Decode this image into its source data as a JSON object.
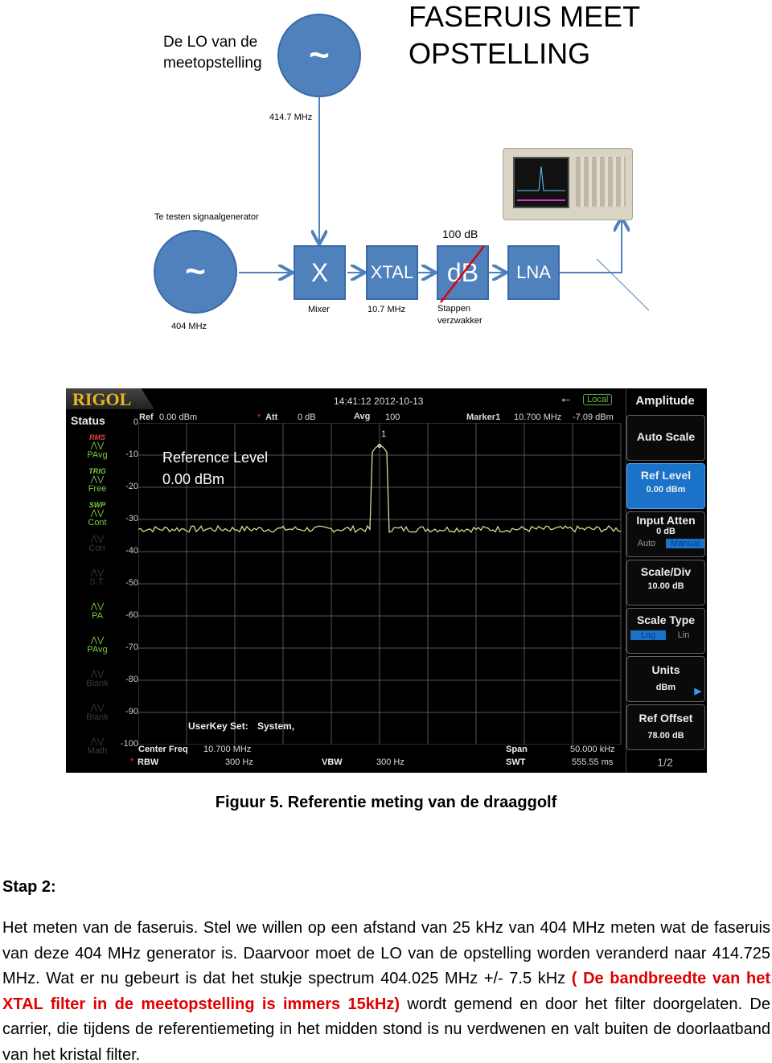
{
  "diagram": {
    "title_line1": "FASERUIS MEET",
    "title_line2": "OPSTELLING",
    "lo_label_line1": "De LO van de",
    "lo_label_line2": "meetopstelling",
    "lo_symbol": "~",
    "lo_freq": "414.7 MHz",
    "generator_label": "Te testen signaalgenerator",
    "generator_symbol": "~",
    "generator_freq": "404 MHz",
    "blocks": [
      {
        "label": "X",
        "caption": "Mixer"
      },
      {
        "label": "XTAL",
        "caption": "10.7 MHz"
      },
      {
        "label": "dB",
        "caption": "Stappen verzwakker"
      },
      {
        "label": "LNA",
        "caption": ""
      }
    ],
    "attenuator_value": "100 dB",
    "colors": {
      "block": "#4f81bd",
      "line": "#4f81bd",
      "attenuator_slash": "#e00000"
    }
  },
  "analyzer": {
    "brand": "RIGOL",
    "datetime": "14:41:12 2012-10-13",
    "local_badge": "Local",
    "status_title": "Status",
    "status_items": [
      {
        "top": "RMS",
        "label": "PAvg"
      },
      {
        "top": "TRIG",
        "label": "Free"
      },
      {
        "top": "SWP",
        "label": "Cont"
      },
      {
        "top": "",
        "label": "Corr"
      },
      {
        "top": "",
        "label": "S.T."
      },
      {
        "top": "",
        "label": "PA"
      },
      {
        "top": "",
        "label": "PAvg"
      },
      {
        "top": "",
        "label": "Blank"
      },
      {
        "top": "",
        "label": "Blank"
      },
      {
        "top": "",
        "label": "Math"
      }
    ],
    "header": {
      "ref_label": "Ref",
      "ref_value": "0.00 dBm",
      "att_label": "Att",
      "att_value": "0 dB",
      "avg_label": "Avg",
      "avg_value": "100",
      "marker_label": "Marker1",
      "marker_freq": "10.700 MHz",
      "marker_level": "-7.09 dBm"
    },
    "y_ticks": [
      "0",
      "-10",
      "-20",
      "-30",
      "-40",
      "-50",
      "-60",
      "-70",
      "-80",
      "-90",
      "-100"
    ],
    "overlay_line1": "Reference Level",
    "overlay_line2": "0.00 dBm",
    "marker_number": "1",
    "userkey_label": "UserKey Set:",
    "userkey_value": "System,",
    "footer": {
      "center_label": "Center Freq",
      "center_value": "10.700 MHz",
      "span_label": "Span",
      "span_value": "50.000 kHz",
      "rbw_label": "RBW",
      "rbw_value": "300 Hz",
      "vbw_label": "VBW",
      "vbw_value": "300 Hz",
      "swt_label": "SWT",
      "swt_value": "555.55 ms"
    },
    "trace": {
      "noise_floor_dbm": -33,
      "peak_dbm": -7.09,
      "peak_position": "center",
      "color": "#d8d890"
    },
    "menu": {
      "title": "Amplitude",
      "auto_scale": "Auto Scale",
      "ref_level": "Ref Level",
      "ref_level_value": "0.00 dBm",
      "input_atten": "Input Atten",
      "input_atten_value": "0 dB",
      "auto": "Auto",
      "manual": "Manual",
      "scale_div": "Scale/Div",
      "scale_div_value": "10.00 dB",
      "scale_type": "Scale Type",
      "log": "Log",
      "lin": "Lin",
      "units": "Units",
      "units_value": "dBm",
      "ref_offset": "Ref Offset",
      "ref_offset_value": "78.00 dB",
      "page": "1/2"
    }
  },
  "caption": "Figuur 5. Referentie meting van de draaggolf",
  "step_heading": "Stap 2:",
  "paragraph": {
    "part1": "Het meten van de faseruis. Stel we willen op een afstand van 25 kHz van 404 MHz meten wat de faseruis van deze 404 MHz generator is. Daarvoor moet de LO van de opstelling worden veranderd naar 414.725 MHz. Wat er nu gebeurt is dat het stukje spectrum 404.025 MHz +/- 7.5 kHz ",
    "highlight": "( De bandbreedte van het XTAL filter in de meetopstelling is immers 15kHz)",
    "part2": " wordt gemend en door het filter doorgelaten. De carrier, die tijdens de referentiemeting in het midden stond is nu verdwenen en valt buiten de doorlaatband van het kristal filter."
  }
}
